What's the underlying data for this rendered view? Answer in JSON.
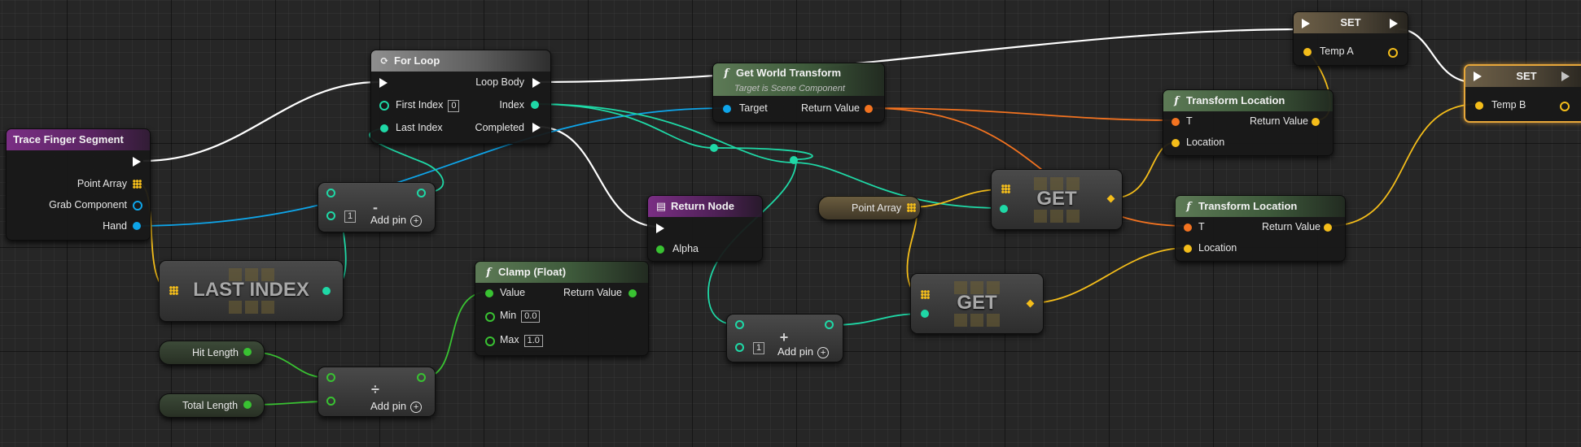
{
  "colors": {
    "exec": "#ffffff",
    "integer": "#1fd8a6",
    "float": "#39c232",
    "vector": "#f4bd1a",
    "transform": "#f37320",
    "object": "#0ea5e9",
    "selection": "#e7a73a"
  },
  "nodes": {
    "trace_finger_segment": {
      "title": "Trace Finger Segment",
      "pins": {
        "point_array": "Point Array",
        "grab_component": "Grab Component",
        "hand": "Hand"
      }
    },
    "for_loop": {
      "title": "For Loop",
      "icon": "loop-icon",
      "pins": {
        "loop_body": "Loop Body",
        "first_index": "First Index",
        "first_index_value": "0",
        "index": "Index",
        "last_index": "Last Index",
        "completed": "Completed"
      }
    },
    "get_world_transform": {
      "title": "Get World Transform",
      "subtitle": "Target is Scene Component",
      "pins": {
        "target": "Target",
        "return_value": "Return Value"
      }
    },
    "set_a": {
      "title": "SET",
      "pins": {
        "var": "Temp A"
      }
    },
    "set_b": {
      "title": "SET",
      "pins": {
        "var": "Temp B"
      }
    },
    "transform_location_1": {
      "title": "Transform Location",
      "pins": {
        "t": "T",
        "location": "Location",
        "return_value": "Return Value"
      }
    },
    "transform_location_2": {
      "title": "Transform Location",
      "pins": {
        "t": "T",
        "location": "Location",
        "return_value": "Return Value"
      }
    },
    "subtract": {
      "op": "-",
      "index_value": "1",
      "add_pin": "Add pin"
    },
    "last_index": {
      "label": "LAST INDEX"
    },
    "return_node": {
      "title": "Return Node",
      "pins": {
        "alpha": "Alpha"
      }
    },
    "clamp": {
      "title": "Clamp (Float)",
      "pins": {
        "value": "Value",
        "min": "Min",
        "min_value": "0.0",
        "max": "Max",
        "max_value": "1.0",
        "return_value": "Return Value"
      }
    },
    "add": {
      "op": "+",
      "index_value": "1",
      "add_pin": "Add pin"
    },
    "get_1": {
      "label": "GET"
    },
    "get_2": {
      "label": "GET"
    },
    "point_array_var": {
      "label": "Point Array"
    },
    "hit_length_var": {
      "label": "Hit Length"
    },
    "total_length_var": {
      "label": "Total Length"
    },
    "divide": {
      "op": "÷",
      "add_pin": "Add pin"
    }
  }
}
